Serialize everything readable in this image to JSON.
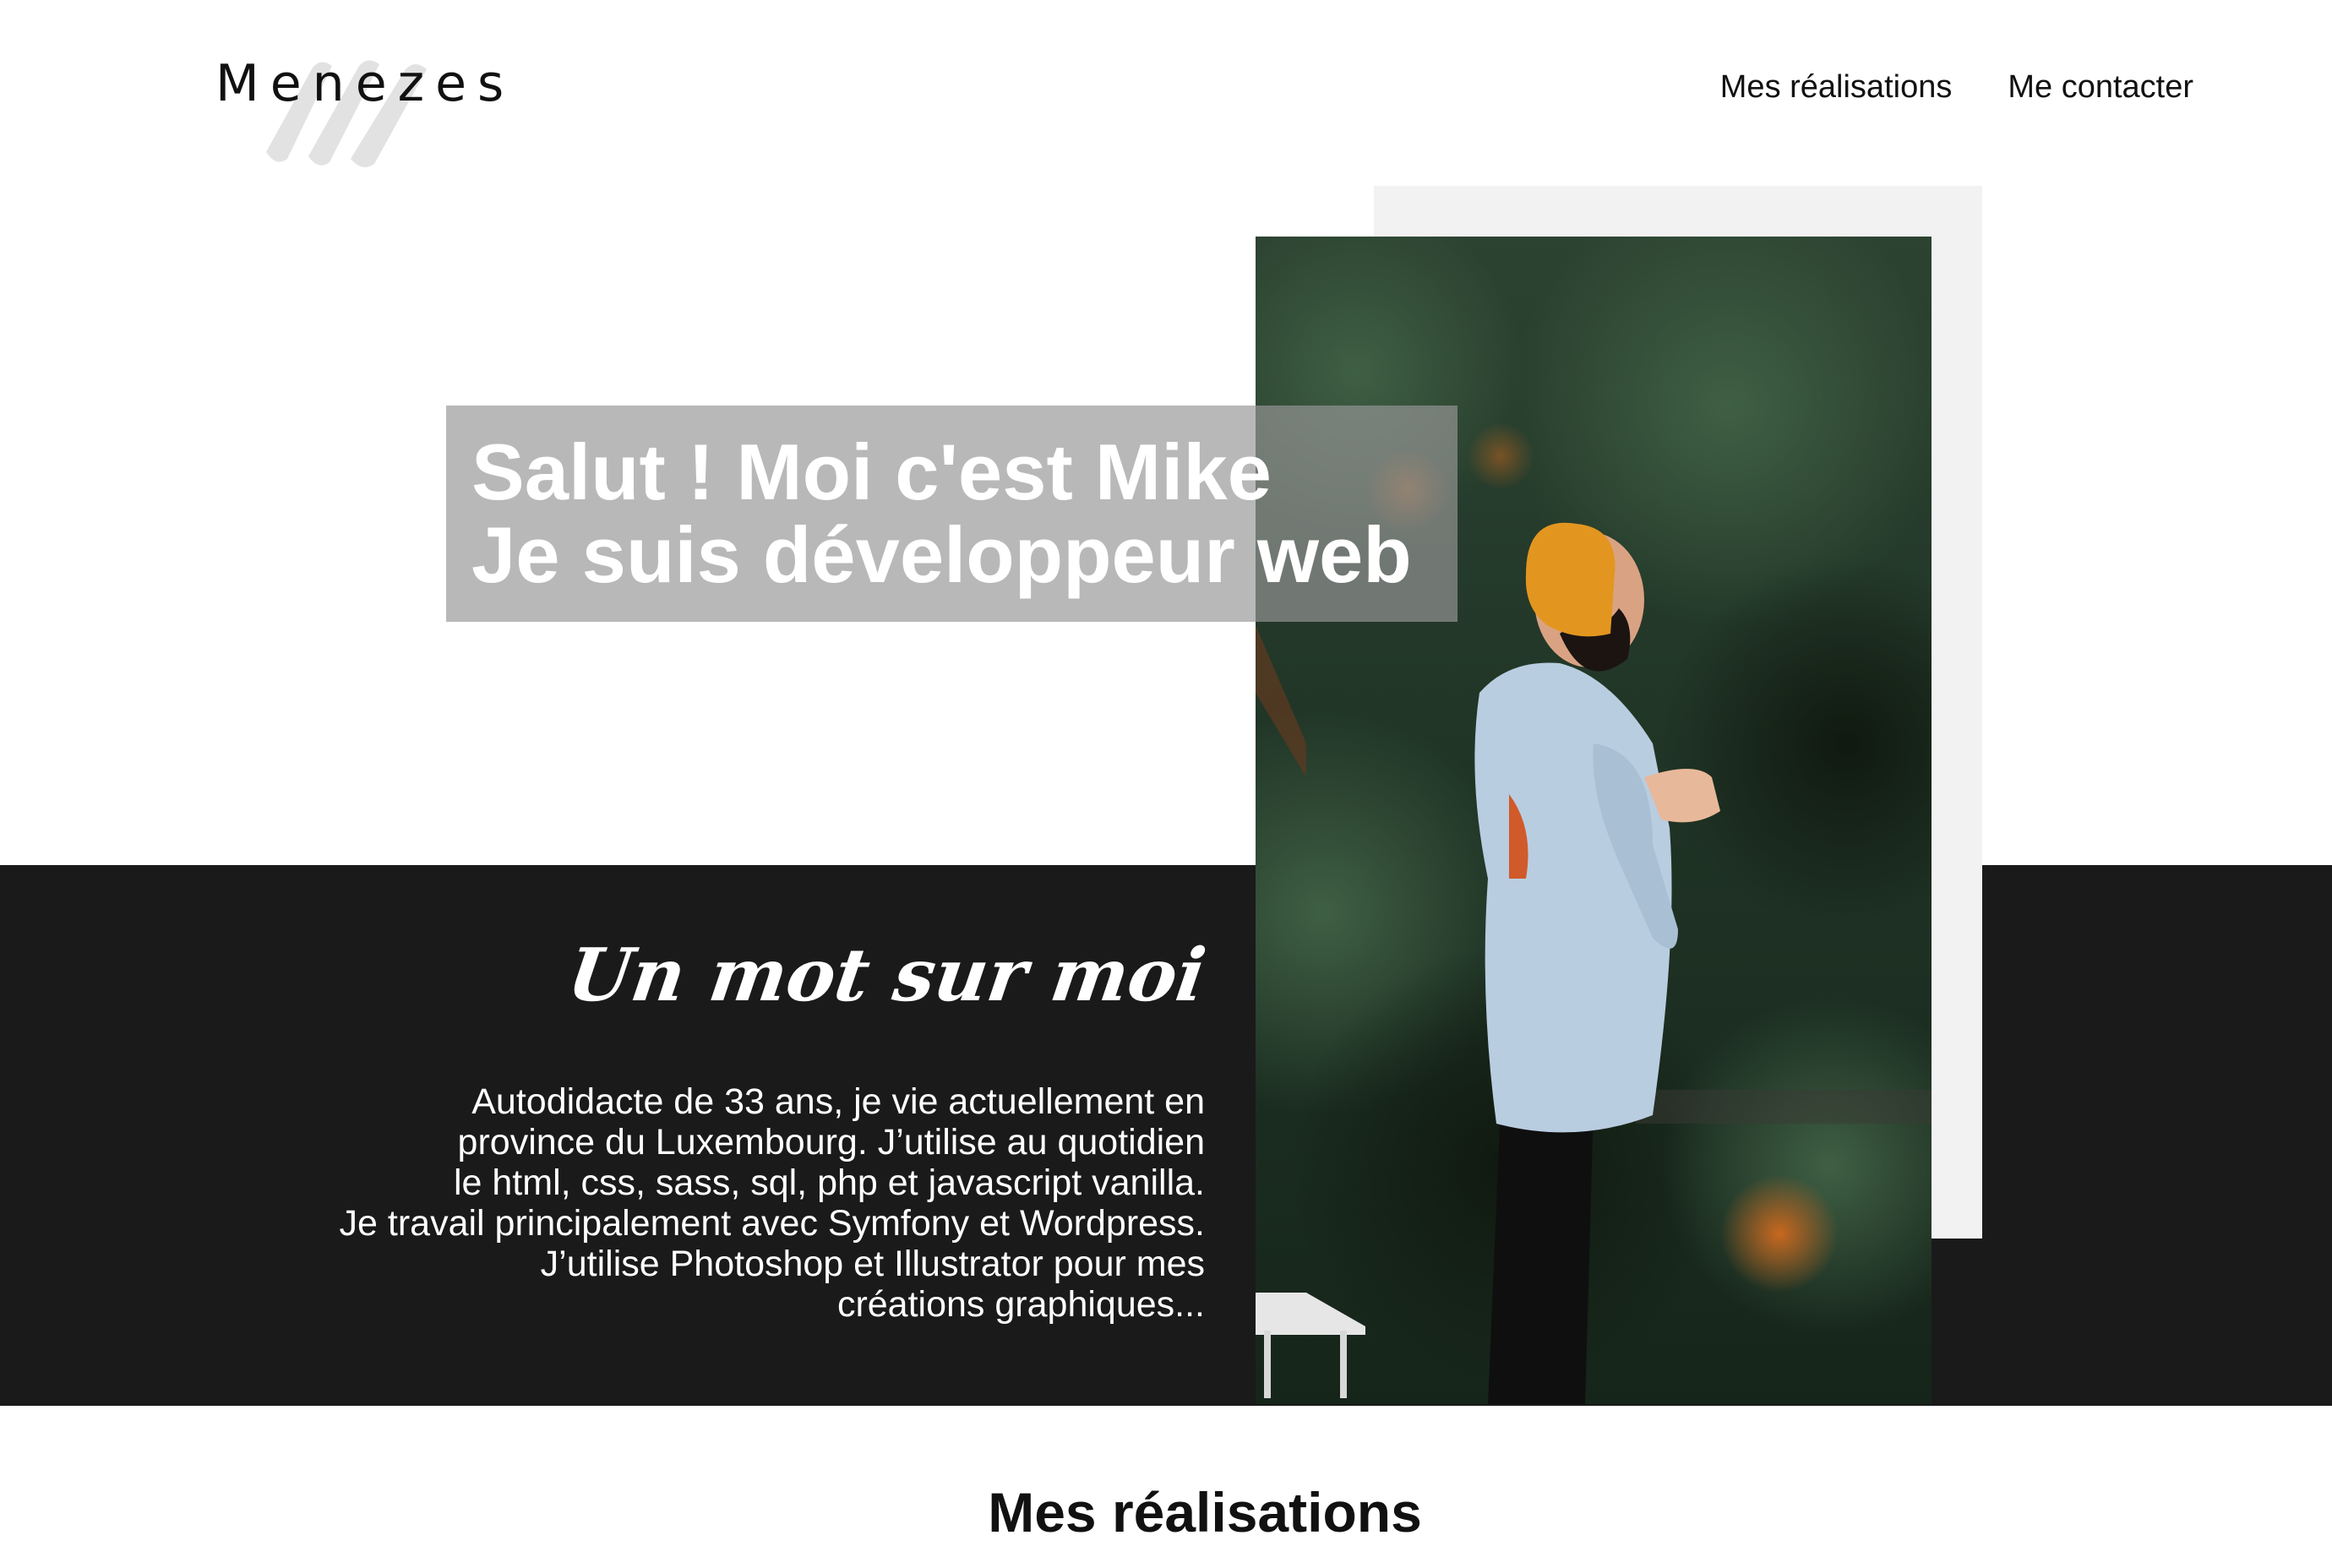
{
  "brand": {
    "logo_text": "Menezes"
  },
  "nav": {
    "items": [
      {
        "label": "Mes réalisations"
      },
      {
        "label": "Me contacter"
      }
    ]
  },
  "hero": {
    "line1": "Salut ! Moi c'est Mike",
    "line2": "Je suis développeur web"
  },
  "about": {
    "title": "Un mot sur moi",
    "lines": [
      "Autodidacte de 33 ans, je vie actuellement en",
      "province du Luxembourg. J’utilise au quotidien",
      "le html, css, sass, sql, php et javascript vanilla.",
      "Je travail principalement avec Symfony et Wordpress.",
      "J’utilise Photoshop et Illustrator pour mes",
      "créations graphiques..."
    ]
  },
  "works": {
    "title": "Mes réalisations"
  },
  "colors": {
    "dark_band": "#1a1a1a",
    "beanie": "#e3961f",
    "hoodie": "#b9cde0"
  },
  "icons": {
    "logo_brush": "brush-strokes-icon"
  }
}
